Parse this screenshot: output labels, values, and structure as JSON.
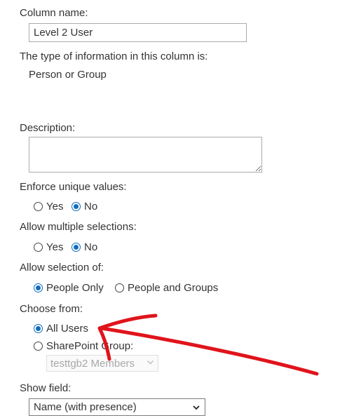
{
  "column_name": {
    "label": "Column name:",
    "value": "Level 2 User"
  },
  "info_type": {
    "label": "The type of information in this column is:",
    "value": "Person or Group"
  },
  "description": {
    "label": "Description:",
    "value": ""
  },
  "enforce_unique": {
    "label": "Enforce unique values:",
    "options": [
      "Yes",
      "No"
    ],
    "selected": "No"
  },
  "allow_multiple": {
    "label": "Allow multiple selections:",
    "options": [
      "Yes",
      "No"
    ],
    "selected": "No"
  },
  "allow_selection_of": {
    "label": "Allow selection of:",
    "options": [
      "People Only",
      "People and Groups"
    ],
    "selected": "People Only"
  },
  "choose_from": {
    "label": "Choose from:",
    "options": [
      "All Users",
      "SharePoint Group:"
    ],
    "selected": "All Users",
    "group_select_value": "testtgb2 Members"
  },
  "show_field": {
    "label": "Show field:",
    "value": "Name (with presence)"
  },
  "colors": {
    "radio_accent": "#0f6cbd",
    "annotation_arrow": "#e0141b"
  }
}
